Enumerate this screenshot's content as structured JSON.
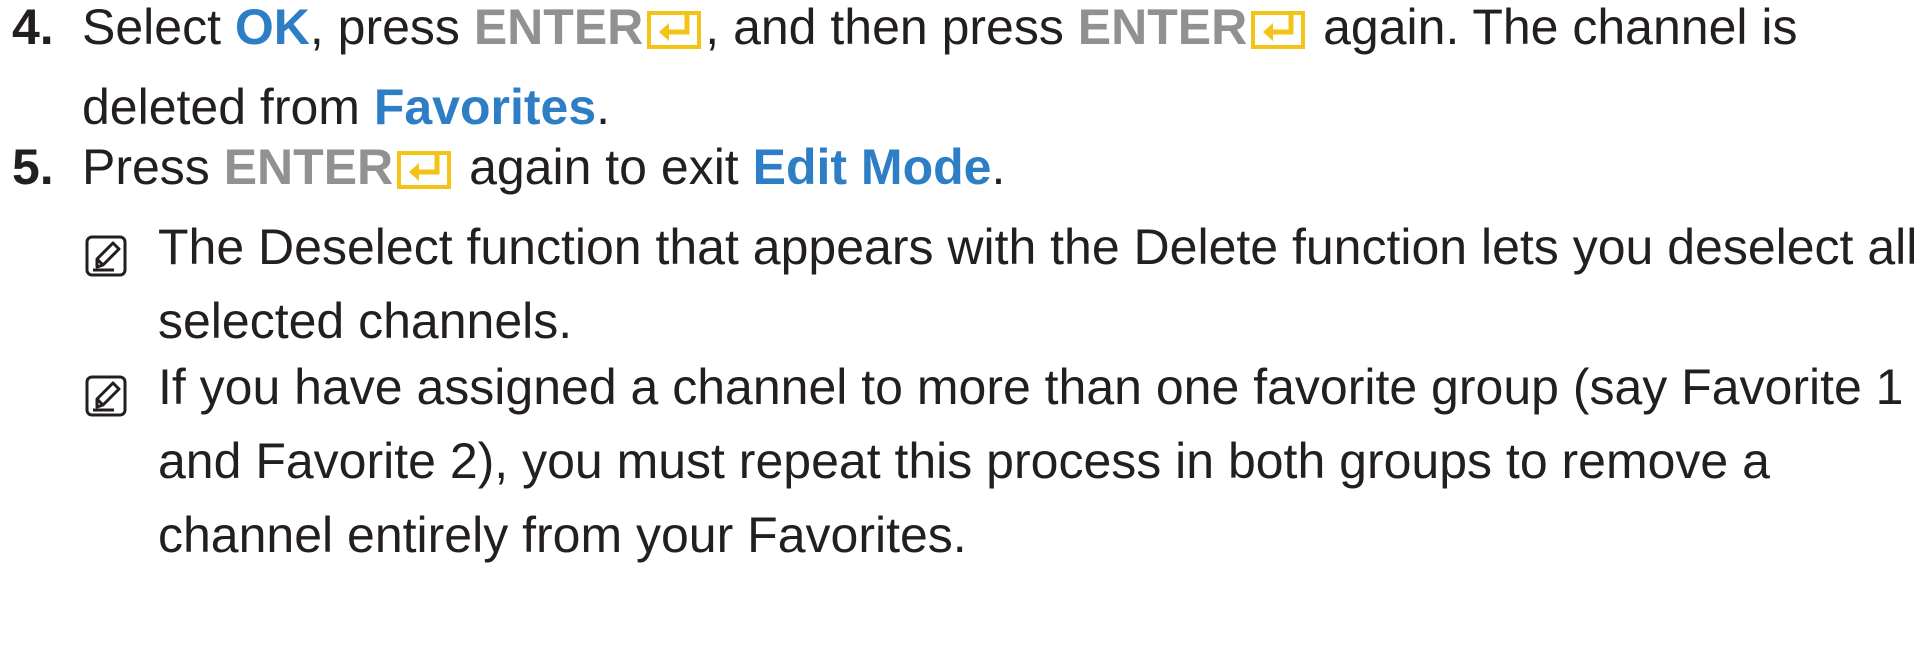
{
  "steps": [
    {
      "number": "4.",
      "parts": {
        "t1": "Select ",
        "ok": "OK",
        "t2": ", press ",
        "enter1": "ENTER",
        "t3": ", and then press ",
        "enter2": "ENTER",
        "t4": " again. The channel is deleted from ",
        "favorites": "Favorites",
        "t5": "."
      }
    },
    {
      "number": "5.",
      "parts": {
        "t1": "Press ",
        "enter": "ENTER",
        "t2": " again to exit ",
        "edit_mode": "Edit Mode",
        "t3": "."
      }
    }
  ],
  "notes": [
    {
      "icon": "note-icon",
      "text": "The Deselect function that appears with the Delete function lets you deselect all selected channels."
    },
    {
      "icon": "note-icon",
      "text": "If you have assigned a channel to more than one favorite group (say Favorite 1 and Favorite 2), you must repeat this process in both groups to remove a channel entirely from your Favorites."
    }
  ],
  "colors": {
    "text": "#231f20",
    "keyword_blue": "#2e7ec6",
    "button_gray": "#919191",
    "enter_icon_yellow": "#f3c318"
  }
}
